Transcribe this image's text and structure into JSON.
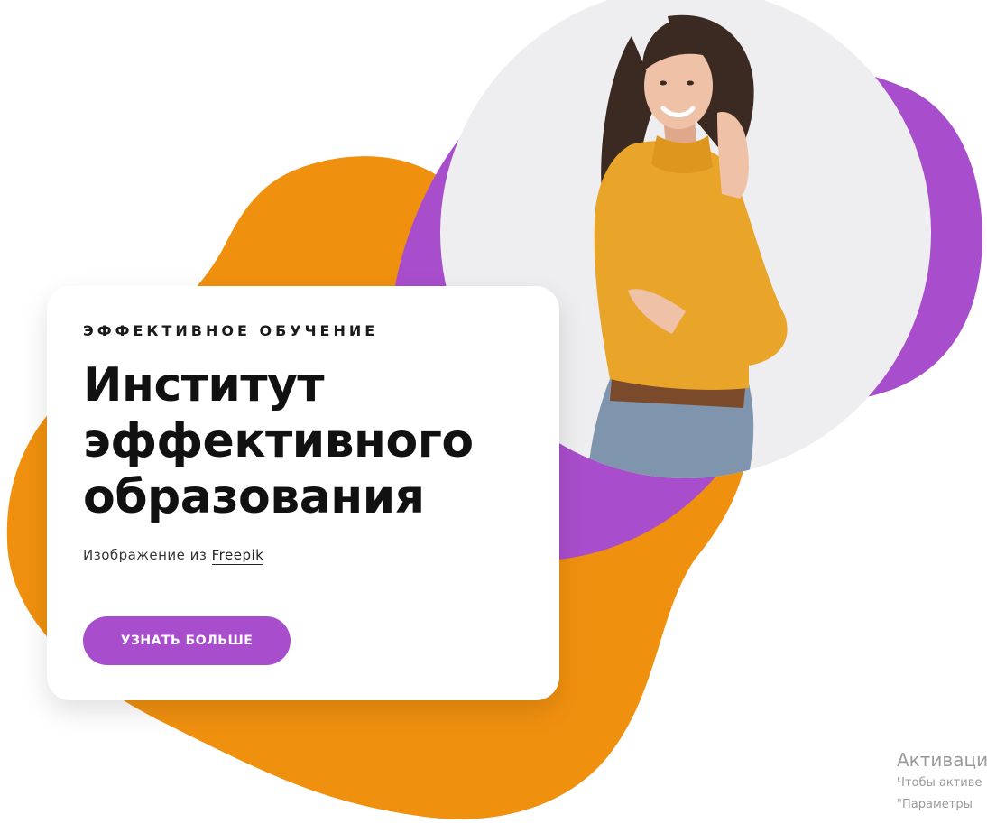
{
  "hero": {
    "eyebrow": "ЭФФЕКТИВНОЕ ОБУЧЕНИЕ",
    "title_lines": [
      "Институт",
      "эффективного",
      "образования"
    ],
    "credit_prefix": "Изображение из ",
    "credit_link": "Freepik",
    "cta_label": "УЗНАТЬ БОЛЬШЕ"
  },
  "watermark": {
    "title": "Активаци",
    "line1": "Чтобы активе",
    "line2": "\"Параметры"
  },
  "colors": {
    "orange": "#f0900f",
    "purple": "#a84dcb",
    "photo_bg": "#eeeef0",
    "sweater": "#e9a42a",
    "jeans": "#7f94ad"
  }
}
